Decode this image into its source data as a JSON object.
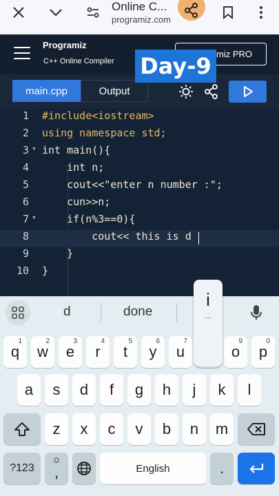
{
  "browser": {
    "title": "Online C...",
    "domain": "programiz.com"
  },
  "header": {
    "logo": "Programiz",
    "subtitle": "C++ Online Compiler",
    "pro_button": "Programiz PRO",
    "overlay_badge": "Day-9"
  },
  "tabs": {
    "file_tab": "main.cpp",
    "output_tab": "Output"
  },
  "colors": {
    "accent": "#2f78dc",
    "editor_bg": "#142235",
    "keyword": "#e2b96a",
    "string": "#98a85c"
  },
  "editor": {
    "lines": [
      {
        "num": "1",
        "fold": "",
        "code": "#include<iostream>"
      },
      {
        "num": "2",
        "fold": "",
        "code": "using namespace std;"
      },
      {
        "num": "3",
        "fold": "▾",
        "code": "int main(){"
      },
      {
        "num": "4",
        "fold": "",
        "code": "    int n;"
      },
      {
        "num": "5",
        "fold": "",
        "code": "    cout<<\"enter n number :\";"
      },
      {
        "num": "6",
        "fold": "",
        "code": "    cun>>n;"
      },
      {
        "num": "7",
        "fold": "▾",
        "code": "    if(n%3==0){"
      },
      {
        "num": "8",
        "fold": "",
        "code": "        cout<< this is d"
      },
      {
        "num": "9",
        "fold": "",
        "code": "    }"
      },
      {
        "num": "10",
        "fold": "",
        "code": "}"
      }
    ]
  },
  "keyboard": {
    "suggestions": [
      "d",
      "done",
      "i"
    ],
    "popup_char": "i",
    "popup_more": "...",
    "row1": [
      {
        "k": "q",
        "h": "1"
      },
      {
        "k": "w",
        "h": "2"
      },
      {
        "k": "e",
        "h": "3"
      },
      {
        "k": "r",
        "h": "4"
      },
      {
        "k": "t",
        "h": "5"
      },
      {
        "k": "y",
        "h": "6"
      },
      {
        "k": "u",
        "h": "7"
      },
      {
        "k": "i",
        "h": "8"
      },
      {
        "k": "o",
        "h": "9"
      },
      {
        "k": "p",
        "h": "0"
      }
    ],
    "row2": [
      "a",
      "s",
      "d",
      "f",
      "g",
      "h",
      "j",
      "k",
      "l"
    ],
    "row3": [
      "z",
      "x",
      "c",
      "v",
      "b",
      "n",
      "m"
    ],
    "symbols_key": "?123",
    "comma_key": ",",
    "space_label": "English",
    "period_key": "."
  }
}
